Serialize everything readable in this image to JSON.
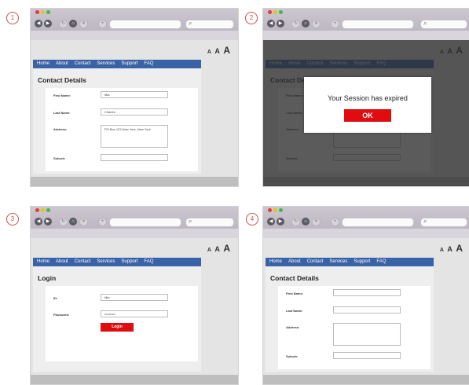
{
  "steps": [
    "1",
    "2",
    "3",
    "4"
  ],
  "colors": {
    "accent": "#3a62a7",
    "danger": "#e00d10",
    "traffic_red": "#e53b30",
    "traffic_yellow": "#e8c21c",
    "traffic_green": "#43b649"
  },
  "browser": {
    "nav_icons": [
      "back-icon",
      "forward-icon",
      "refresh-icon",
      "home-icon",
      "close-icon",
      "new-tab-icon"
    ],
    "search_icon": "search-icon",
    "text_size": {
      "small": "A",
      "medium": "A",
      "large": "A"
    }
  },
  "nav": [
    "Home",
    "About",
    "Contact",
    "Services",
    "Support",
    "FAQ"
  ],
  "contact": {
    "title": "Contact Details",
    "fields": {
      "first_name": {
        "label": "First Name:",
        "value": "Mia"
      },
      "last_name": {
        "label": "Last Name:",
        "value": "Charles"
      },
      "address": {
        "label": "Address:",
        "value": "PO Box 123 New York, New York"
      },
      "suburb": {
        "label": "Suburb:",
        "value": ""
      }
    }
  },
  "modal": {
    "message": "Your Session has expired",
    "ok_label": "OK"
  },
  "login": {
    "title": "Login",
    "id_label": "ID:",
    "id_value": "Mia",
    "password_label": "Password:",
    "password_value": "••••••••••",
    "button_label": "Login"
  }
}
